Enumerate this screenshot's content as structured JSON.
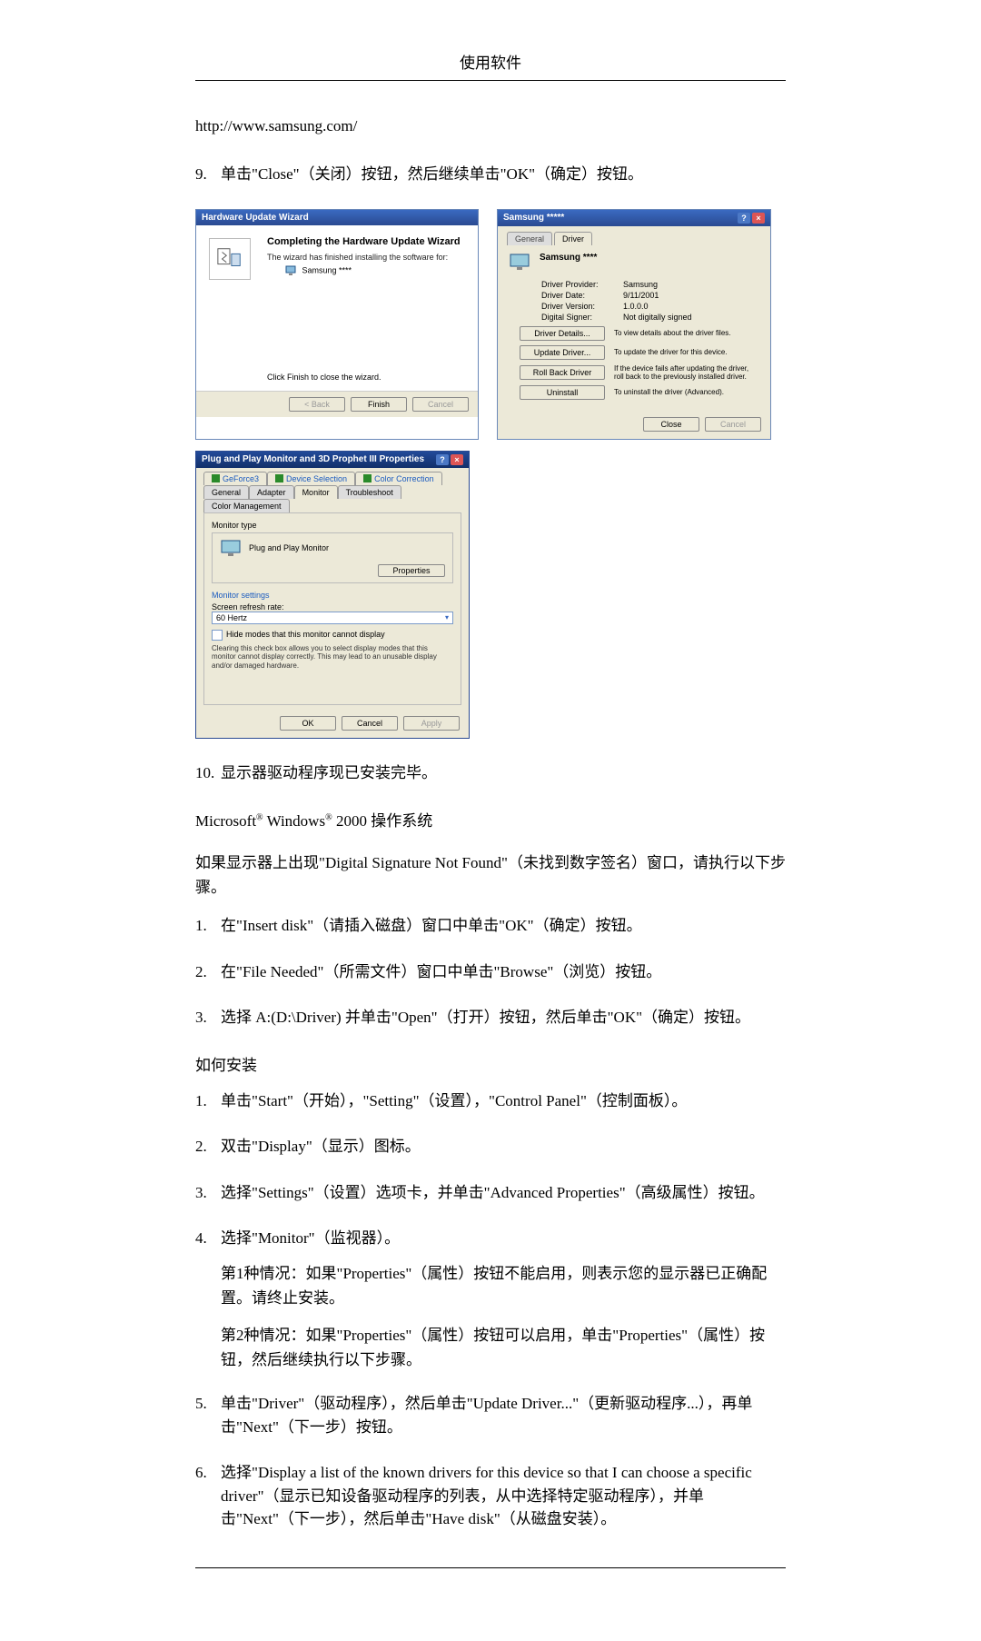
{
  "header": {
    "title": "使用软件"
  },
  "url": "http://www.samsung.com/",
  "step9": {
    "num": "9.",
    "text": "单击\"Close\"（关闭）按钮，然后继续单击\"OK\"（确定）按钮。"
  },
  "wizard": {
    "title": "Hardware Update Wizard",
    "heading": "Completing the Hardware Update Wizard",
    "sub": "The wizard has finished installing the software for:",
    "item": "Samsung ****",
    "closeInstr": "Click Finish to close the wizard.",
    "back": "< Back",
    "finish": "Finish",
    "cancel": "Cancel"
  },
  "prop": {
    "title": "Samsung *****",
    "tabs": {
      "general": "General",
      "driver": "Driver"
    },
    "name": "Samsung ****",
    "kv": {
      "provider_k": "Driver Provider:",
      "provider_v": "Samsung",
      "date_k": "Driver Date:",
      "date_v": "9/11/2001",
      "version_k": "Driver Version:",
      "version_v": "1.0.0.0",
      "signer_k": "Digital Signer:",
      "signer_v": "Not digitally signed"
    },
    "actions": {
      "details_btn": "Driver Details...",
      "details_desc": "To view details about the driver files.",
      "update_btn": "Update Driver...",
      "update_desc": "To update the driver for this device.",
      "rollback_btn": "Roll Back Driver",
      "rollback_desc": "If the device fails after updating the driver, roll back to the previously installed driver.",
      "uninstall_btn": "Uninstall",
      "uninstall_desc": "To uninstall the driver (Advanced)."
    },
    "close": "Close",
    "cancel": "Cancel"
  },
  "mon": {
    "title": "Plug and Play Monitor and 3D Prophet III Properties",
    "tabs": {
      "geforce": "GeForce3",
      "device_sel": "Device Selection",
      "color_corr": "Color Correction",
      "general": "General",
      "adapter": "Adapter",
      "monitor": "Monitor",
      "troubleshoot": "Troubleshoot",
      "color_mgmt": "Color Management"
    },
    "monitor_type_label": "Monitor type",
    "monitor_name": "Plug and Play Monitor",
    "properties_btn": "Properties",
    "settings_label": "Monitor settings",
    "refresh_label": "Screen refresh rate:",
    "refresh_value": "60 Hertz",
    "hide_label": "Hide modes that this monitor cannot display",
    "hide_hint": "Clearing this check box allows you to select display modes that this monitor cannot display correctly. This may lead to an unusable display and/or damaged hardware.",
    "ok": "OK",
    "cancel": "Cancel",
    "apply": "Apply"
  },
  "step10": {
    "num": "10.",
    "text": "显示器驱动程序现已安装完毕。"
  },
  "sys_line": {
    "prefix": "Microsoft",
    "mid": " Windows",
    "suffix": " 2000 操作系统"
  },
  "dig_sig_para": "如果显示器上出现\"Digital  Signature  Not  Found\"（未找到数字签名）窗口，请执行以下步骤。",
  "dsig_steps": {
    "s1_num": "1.",
    "s1": "在\"Insert disk\"（请插入磁盘）窗口中单击\"OK\"（确定）按钮。",
    "s2_num": "2.",
    "s2": "在\"File Needed\"（所需文件）窗口中单击\"Browse\"（浏览）按钮。",
    "s3_num": "3.",
    "s3": "选择 A:(D:\\Driver) 并单击\"Open\"（打开）按钮，然后单击\"OK\"（确定）按钮。"
  },
  "install_head": "如何安装",
  "install_steps": {
    "s1_num": "1.",
    "s1": "单击\"Start\"（开始），\"Setting\"（设置），\"Control Panel\"（控制面板）。",
    "s2_num": "2.",
    "s2": "双击\"Display\"（显示）图标。",
    "s3_num": "3.",
    "s3": "选择\"Settings\"（设置）选项卡，并单击\"Advanced Properties\"（高级属性）按钮。",
    "s4_num": "4.",
    "s4": "选择\"Monitor\"（监视器）。",
    "s4_case1": "第1种情况：如果\"Properties\"（属性）按钮不能启用，则表示您的显示器已正确配置。请终止安装。",
    "s4_case2": "第2种情况：如果\"Properties\"（属性）按钮可以启用，单击\"Properties\"（属性）按钮，然后继续执行以下步骤。",
    "s5_num": "5.",
    "s5": "单击\"Driver\"（驱动程序），然后单击\"Update  Driver...\"（更新驱动程序...），再单击\"Next\"（下一步）按钮。",
    "s6_num": "6.",
    "s6": "选择\"Display a list of the known drivers for this device so that I can choose a specific driver\"（显示已知设备驱动程序的列表，从中选择特定驱动程序），并单击\"Next\"（下一步），然后单击\"Have disk\"（从磁盘安装）。"
  }
}
